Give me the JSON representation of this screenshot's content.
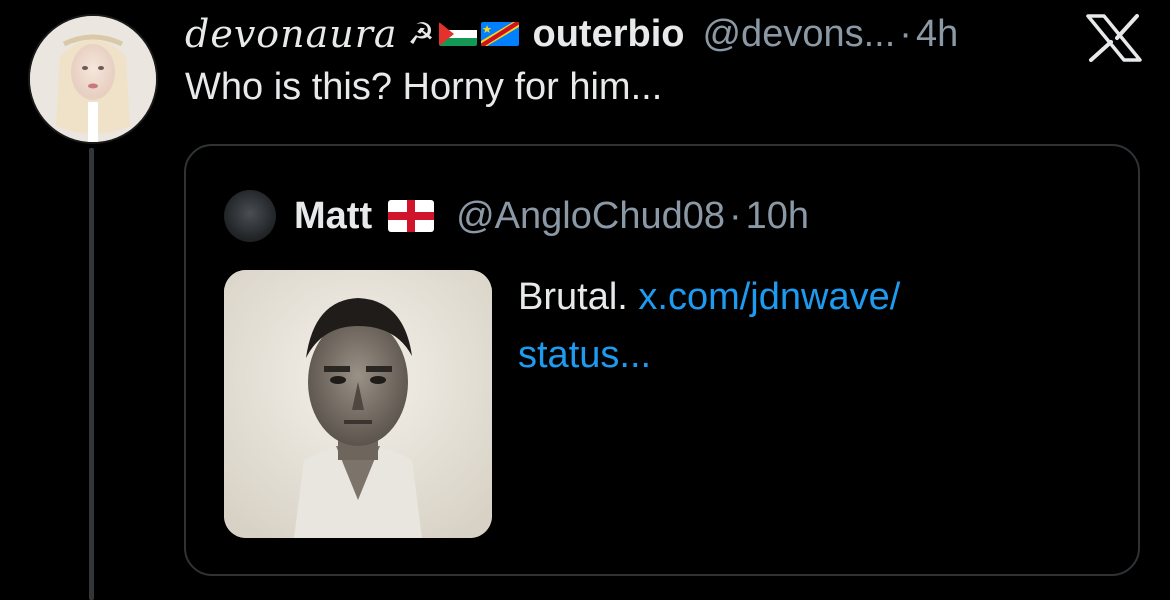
{
  "post": {
    "author_display_name": "devonaura",
    "author_name_suffix": "outerbio",
    "author_handle": "@devons...",
    "separator": "·",
    "time": "4h",
    "text": "Who is this? Horny for him...",
    "flag_icons": [
      "hammer-sickle-icon",
      "palestine-flag-icon",
      "drc-flag-icon"
    ]
  },
  "quoted": {
    "author_name": "Matt",
    "author_handle": "@AngloChud08",
    "separator": "·",
    "time": "10h",
    "text_plain": "Brutal.",
    "link_line1": "x.com/jdnwave/",
    "link_line2": "status...",
    "flag_icon": "england-flag-icon"
  },
  "icons": {
    "brand": "x-logo-icon"
  },
  "colors": {
    "background": "#000000",
    "text_primary": "#e7e9ea",
    "text_secondary": "#8b98a5",
    "link": "#1d9bf0",
    "border": "#2f3336"
  }
}
